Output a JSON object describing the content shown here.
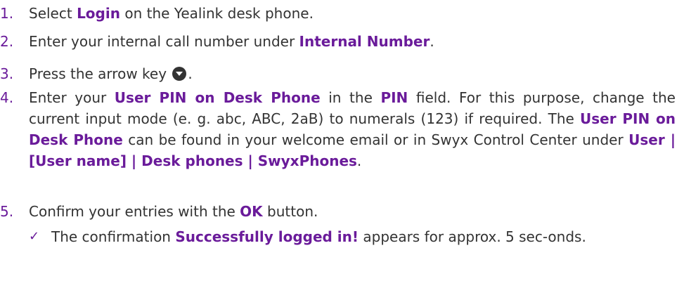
{
  "steps": [
    {
      "number": "1.",
      "t1": "Select ",
      "b1": "Login",
      "t2": " on the Yealink desk phone."
    },
    {
      "number": "2.",
      "t1": "Enter your internal call number under ",
      "b1": "Internal Number",
      "t2": "."
    },
    {
      "number": "3.",
      "t1": "Press the arrow key ",
      "t2": "."
    },
    {
      "number": "4.",
      "t1": "Enter your ",
      "b1": "User PIN on Desk Phone",
      "t2": " in the ",
      "b2": "PIN",
      "t3": " field. For this purpose, change the current input mode (e. g. abc, ABC, 2aB) to numerals (123) if required. The ",
      "b3": "User PIN on Desk Phone",
      "t4": " can be found in your welcome email or in Swyx Control Center under ",
      "b4": "User | [User name] | Desk phones | SwyxPhones",
      "t5": "."
    },
    {
      "number": "5.",
      "t1": "Confirm your entries with the ",
      "b1": "OK",
      "t2": " button."
    }
  ],
  "result": {
    "check": "✓",
    "t1": "The confirmation ",
    "b1": "Successfully logged in!",
    "t2": " appears for approx. 5 sec-onds."
  }
}
